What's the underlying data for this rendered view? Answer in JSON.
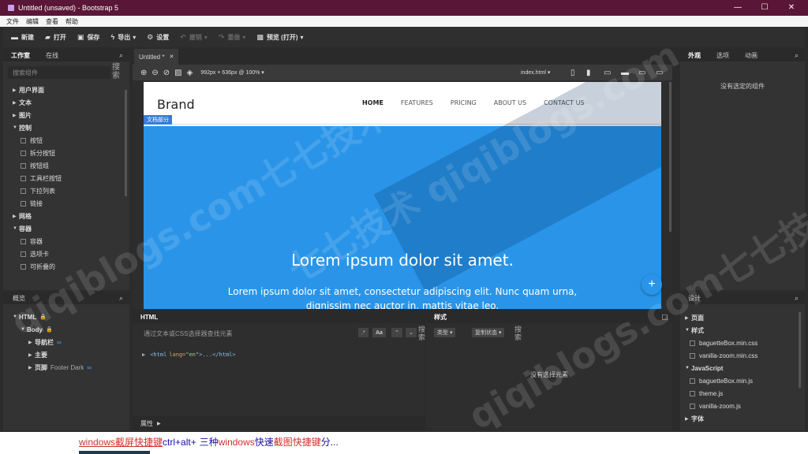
{
  "window": {
    "title": "Untitled (unsaved) - Bootstrap 5",
    "min": "—",
    "max": "☐",
    "close": "✕"
  },
  "menu": [
    "文件",
    "编辑",
    "查看",
    "帮助"
  ],
  "toolbar": {
    "new": "新建",
    "open": "打开",
    "save": "保存",
    "export": "导出",
    "settings": "设置",
    "undo": "撤销",
    "redo": "重做",
    "preview": "预览 (打开)"
  },
  "left_top": {
    "tabs": [
      "工作室",
      "在线"
    ],
    "search_placeholder": "搜索组件",
    "search_btn": "搜索",
    "items": [
      {
        "label": "用户界面",
        "level": 0,
        "open": false
      },
      {
        "label": "文本",
        "level": 0,
        "open": false
      },
      {
        "label": "图片",
        "level": 0,
        "open": false
      },
      {
        "label": "控制",
        "level": 0,
        "open": true
      },
      {
        "label": "按钮",
        "level": 1
      },
      {
        "label": "拆分按钮",
        "level": 1
      },
      {
        "label": "按钮组",
        "level": 1
      },
      {
        "label": "工具栏按钮",
        "level": 1
      },
      {
        "label": "下拉列表",
        "level": 1
      },
      {
        "label": "链接",
        "level": 1
      },
      {
        "label": "网格",
        "level": 0,
        "open": false
      },
      {
        "label": "容器",
        "level": 0,
        "open": true
      },
      {
        "label": "容器",
        "level": 1
      },
      {
        "label": "选项卡",
        "level": 1
      },
      {
        "label": "可折叠的",
        "level": 1
      }
    ]
  },
  "left_bottom": {
    "title": "概览",
    "items": [
      {
        "label": "HTML",
        "level": 0,
        "lock": "🔒"
      },
      {
        "label": "Body",
        "level": 1,
        "lock": "🔒"
      },
      {
        "label": "导航栏",
        "level": 2,
        "link": "∞"
      },
      {
        "label": "主要",
        "level": 2
      },
      {
        "label": "页脚",
        "extra": "Footer Dark",
        "level": 2,
        "link": "∞"
      }
    ]
  },
  "canvas": {
    "tab": "Untitled *",
    "tab_close": "✕",
    "viewport": "992px × 636px @ 100% ▾",
    "file": "index.html ▾"
  },
  "site": {
    "brand": "Brand",
    "nav": [
      "HOME",
      "FEATURES",
      "PRICING",
      "ABOUT US",
      "CONTACT US"
    ],
    "section_badge": "文档部分",
    "hero_title": "Lorem ipsum dolor sit amet.",
    "hero_text": "Lorem ipsum dolor sit amet, consectetur adipiscing elit. Nunc quam urna,",
    "hero_text2": "dignissim nec auctor in, mattis vitae leo.",
    "fab": "+"
  },
  "html_panel": {
    "title": "HTML",
    "search_placeholder": "通过文本或CSS选择器查找元素",
    "aa": "Aa",
    "search_btn": "搜索",
    "code_open": "<html",
    "code_attr": "lang=",
    "code_val": "\"en\"",
    "code_close": ">...</html>"
  },
  "style_panel": {
    "title": "样式",
    "btn1": "类型 ▾",
    "btn2": "复制状态 ▾",
    "search_btn": "搜索",
    "empty": "没有选择元素"
  },
  "attr_bar": {
    "label": "属性"
  },
  "right_top": {
    "tabs": [
      "外观",
      "选项",
      "动画"
    ],
    "empty": "没有选定的组件"
  },
  "right_bottom": {
    "title": "设计",
    "items": [
      {
        "label": "页面",
        "level": 0,
        "open": false
      },
      {
        "label": "样式",
        "level": 0,
        "open": true
      },
      {
        "label": "baguetteBox.min.css",
        "level": 1
      },
      {
        "label": "vanilla-zoom.min.css",
        "level": 1
      },
      {
        "label": "JavaScript",
        "level": 0,
        "open": true
      },
      {
        "label": "baguetteBox.min.js",
        "level": 1
      },
      {
        "label": "theme.js",
        "level": 1
      },
      {
        "label": "vanilla-zoom.js",
        "level": 1
      },
      {
        "label": "字体",
        "level": 0,
        "open": false
      }
    ]
  },
  "footer_link": {
    "a": "windows截屏快捷键",
    "b": "ctrl+alt+",
    "c": "三种",
    "d": "windows",
    "e": "快速",
    "f": "截图快捷键",
    "g": "分..."
  },
  "watermark": [
    "qiqiblogs.com七七技术",
    "七七技术 qiqiblogs.com",
    "qiqiblogs.com七七技术"
  ],
  "colors": {
    "titlebar": "#5a1636",
    "hero": "#2a95e8",
    "accent": "#3a7bd5"
  }
}
